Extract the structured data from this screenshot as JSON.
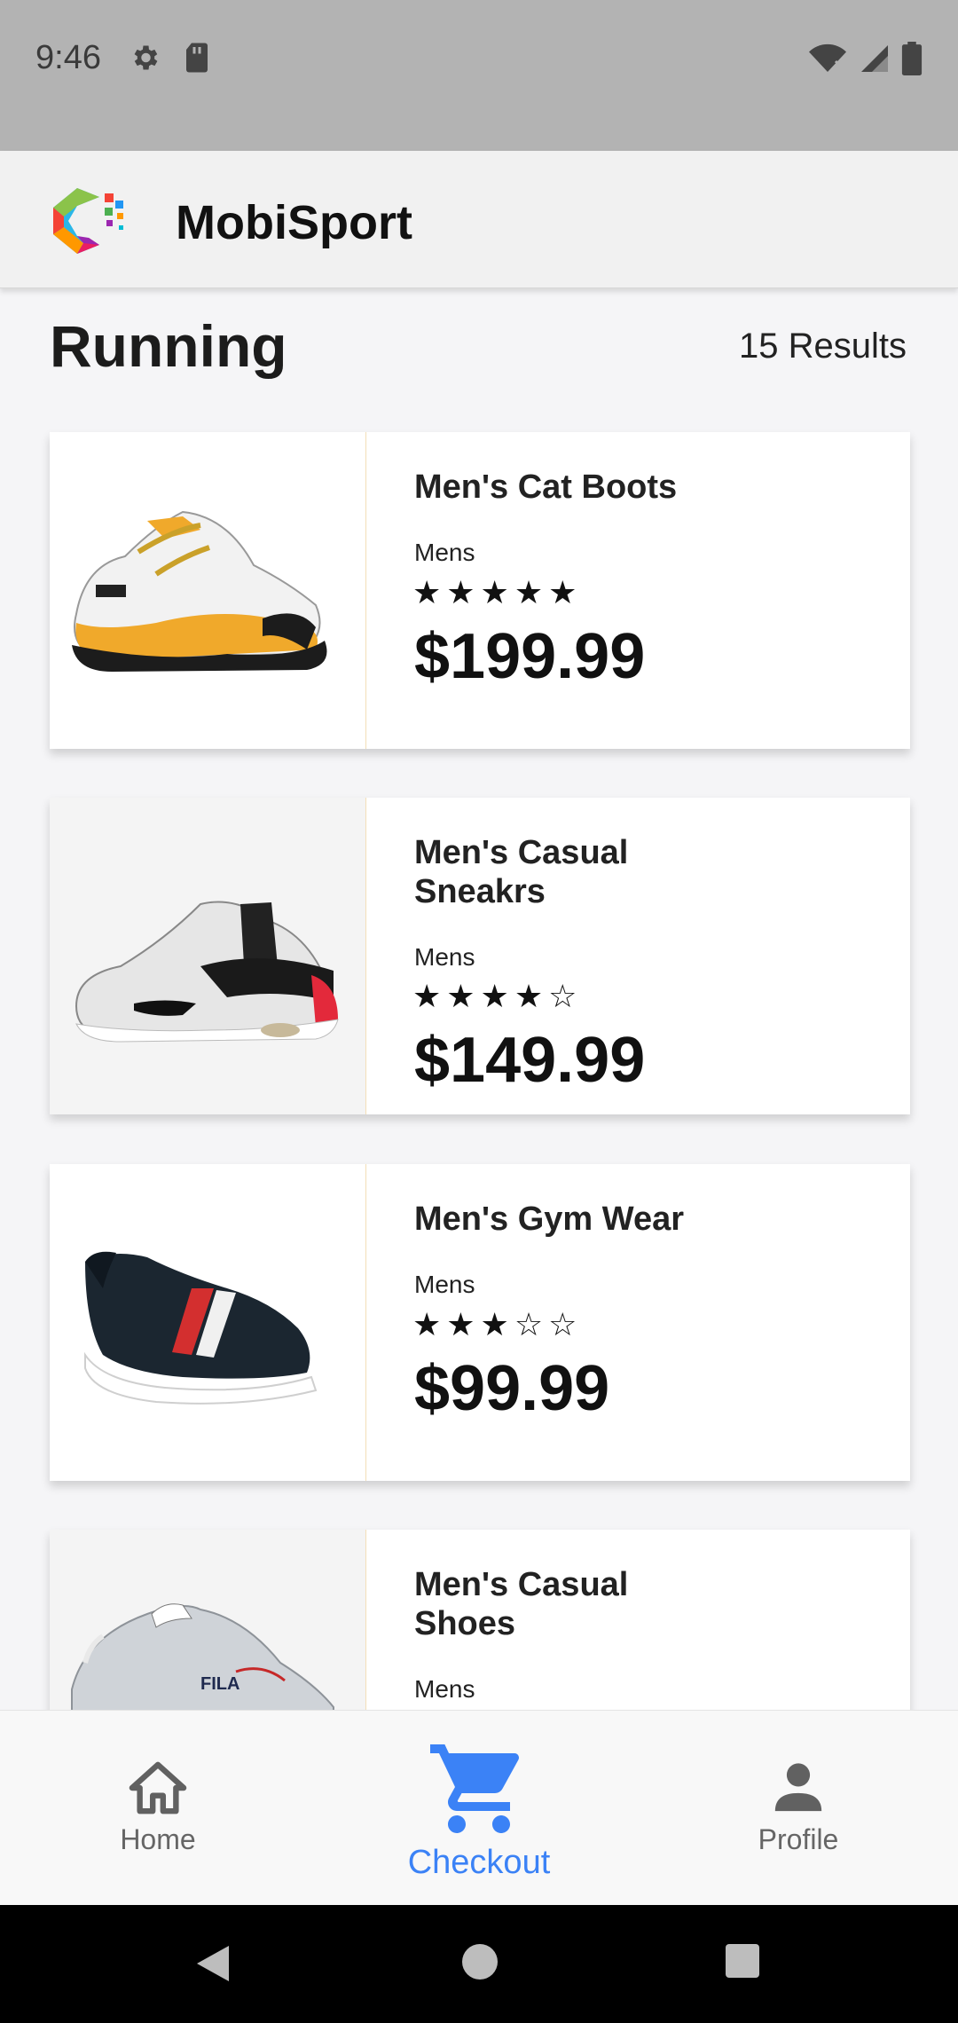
{
  "status_bar": {
    "time": "9:46"
  },
  "app_bar": {
    "title": "MobiSport"
  },
  "section": {
    "title": "Running",
    "results": "15 Results"
  },
  "products": [
    {
      "name": "Men's Cat Boots",
      "category": "Mens",
      "stars": "★★★★★",
      "rating": 5,
      "price": "$199.99"
    },
    {
      "name": "Men's Casual Sneakrs",
      "category": "Mens",
      "stars": "★★★★☆",
      "rating": 4,
      "price": "$149.99"
    },
    {
      "name": "Men's Gym Wear",
      "category": "Mens",
      "stars": "★★★☆☆",
      "rating": 3,
      "price": "$99.99"
    },
    {
      "name": "Men's Casual Shoes",
      "category": "Mens"
    }
  ],
  "bottom_nav": {
    "items": [
      {
        "label": "Home",
        "icon": "home-icon"
      },
      {
        "label": "Checkout",
        "icon": "cart-icon",
        "active": true
      },
      {
        "label": "Profile",
        "icon": "person-icon"
      }
    ]
  },
  "colors": {
    "accent": "#3b82f6",
    "app_bar": "#f1f1f1",
    "status_bar": "#b3b3b3"
  }
}
